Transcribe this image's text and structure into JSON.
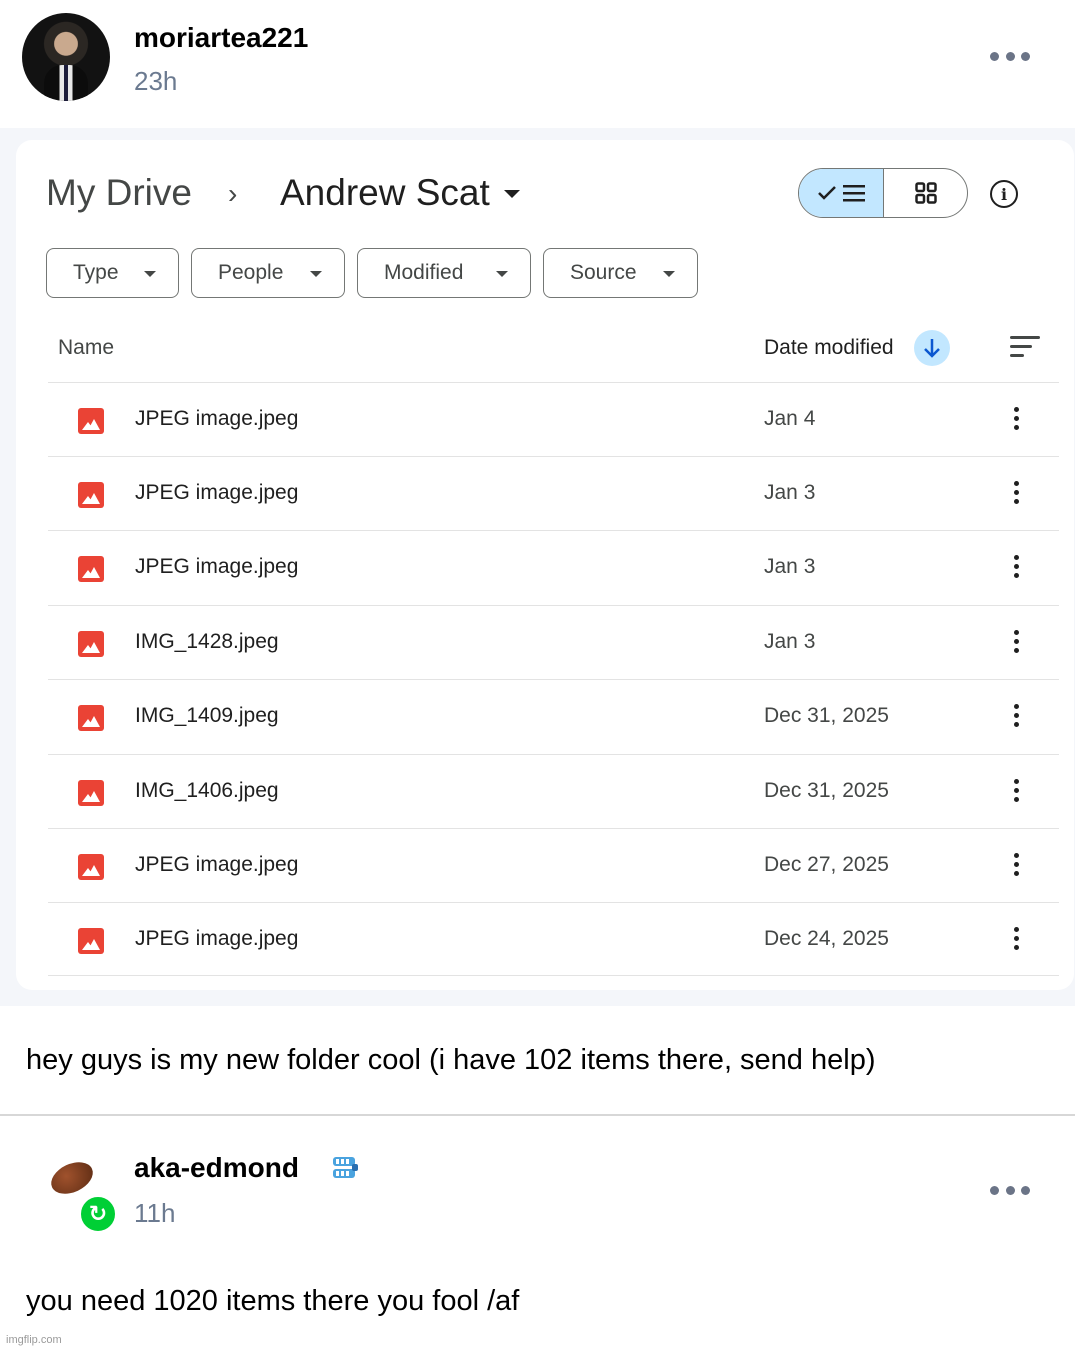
{
  "post": {
    "username": "moriartea221",
    "time": "23h",
    "caption": "hey guys is my new folder cool (i have 102 items there, send help)"
  },
  "drive": {
    "breadcrumb_root": "My Drive",
    "breadcrumb_folder": "Andrew Scat",
    "filters": [
      "Type",
      "People",
      "Modified",
      "Source"
    ],
    "columns": {
      "name": "Name",
      "date": "Date modified"
    },
    "files": [
      {
        "name": "JPEG image.jpeg",
        "date": "Jan 4"
      },
      {
        "name": "JPEG image.jpeg",
        "date": "Jan 3"
      },
      {
        "name": "JPEG image.jpeg",
        "date": "Jan 3"
      },
      {
        "name": "IMG_1428.jpeg",
        "date": "Jan 3"
      },
      {
        "name": "IMG_1409.jpeg",
        "date": "Dec 31, 2025"
      },
      {
        "name": "IMG_1406.jpeg",
        "date": "Dec 31, 2025"
      },
      {
        "name": "JPEG image.jpeg",
        "date": "Dec 27, 2025"
      },
      {
        "name": "JPEG image.jpeg",
        "date": "Dec 24, 2025"
      }
    ]
  },
  "reblog": {
    "username": "aka-edmond",
    "time": "11h",
    "text": "you need 1020 items there you fool /af"
  },
  "watermark": "imgflip.com",
  "colors": {
    "file_icon": "#ea4335",
    "toggle_active": "#c2e7ff",
    "reblog_green": "#00cf35",
    "timestamp": "#6b7a90"
  }
}
